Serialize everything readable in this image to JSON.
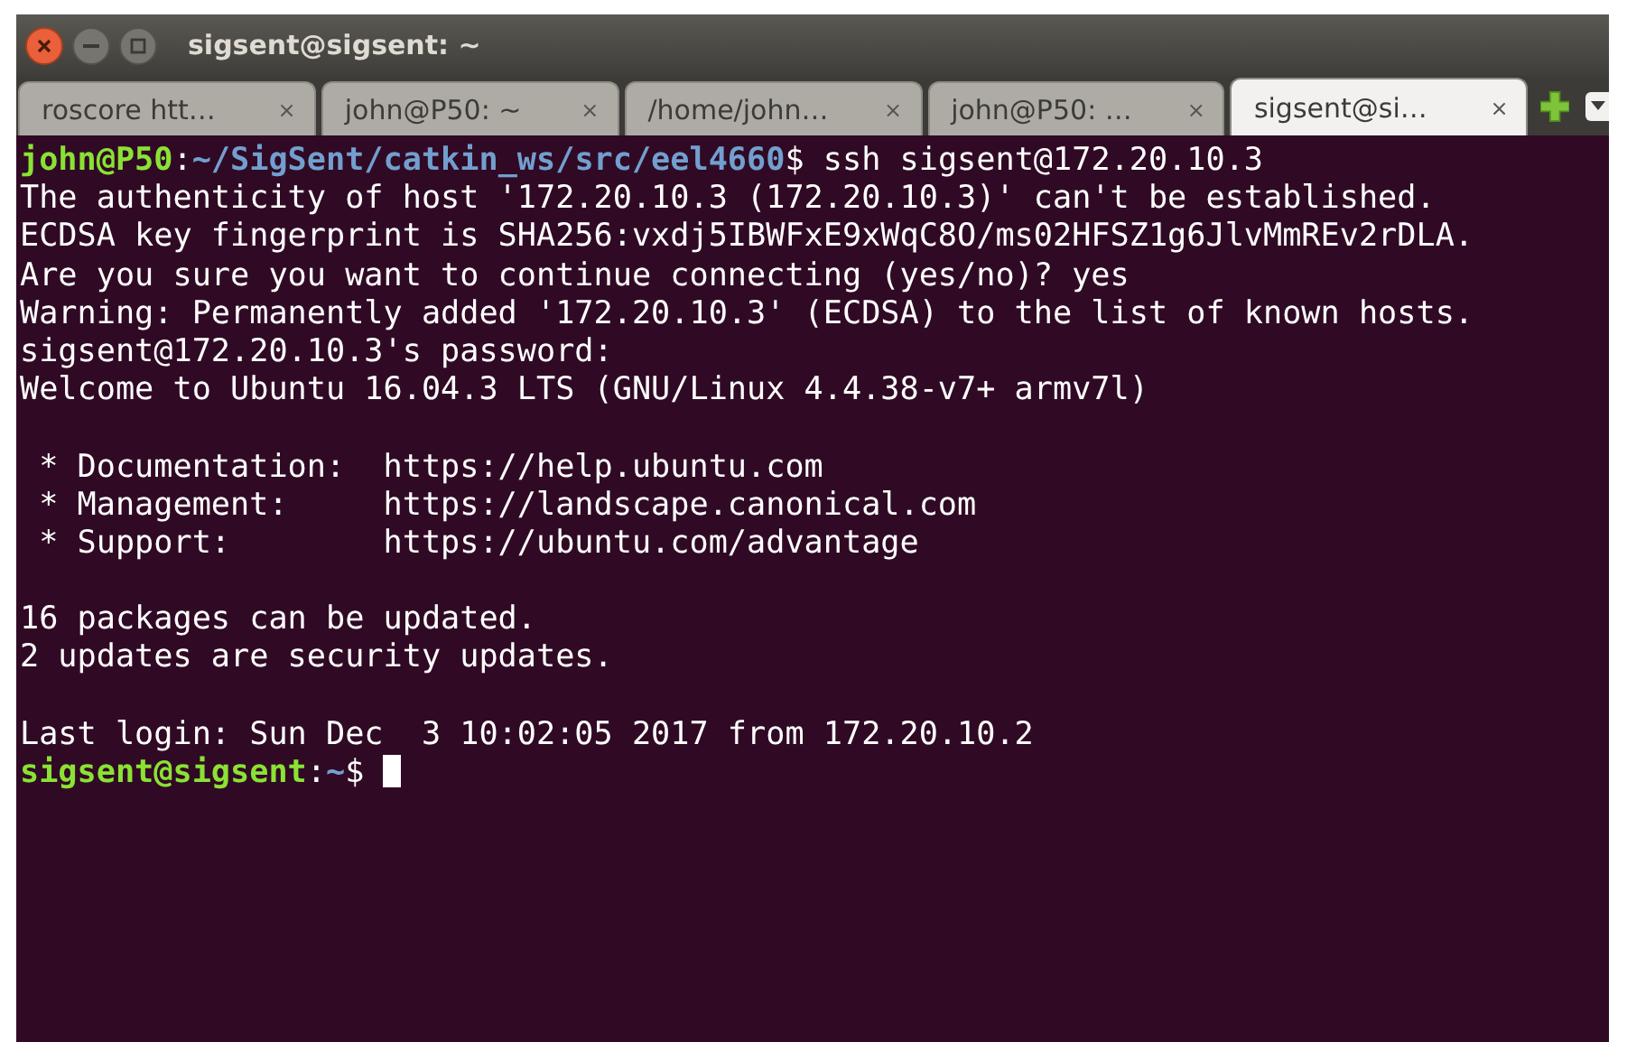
{
  "window": {
    "title": "sigsent@sigsent: ~"
  },
  "tabs": [
    {
      "label": "roscore htt…",
      "close": "×",
      "selected": false
    },
    {
      "label": "john@P50: ~",
      "close": "×",
      "selected": false
    },
    {
      "label": "/home/john…",
      "close": "×",
      "selected": false
    },
    {
      "label": "john@P50: …",
      "close": "×",
      "selected": false
    },
    {
      "label": "sigsent@si…",
      "close": "×",
      "selected": true
    }
  ],
  "terminal": {
    "lines": [
      {
        "kind": "prompt",
        "user": "john@P50",
        "separator": ":",
        "path": "~/SigSent/catkin_ws/src/eel4660",
        "rest": "$ ssh sigsent@172.20.10.3",
        "cursor": false
      },
      {
        "kind": "text",
        "text": "The authenticity of host '172.20.10.3 (172.20.10.3)' can't be established."
      },
      {
        "kind": "text",
        "text": "ECDSA key fingerprint is SHA256:vxdj5IBWFxE9xWqC8O/ms02HFSZ1g6JlvMmREv2rDLA."
      },
      {
        "kind": "text",
        "text": "Are you sure you want to continue connecting (yes/no)? yes"
      },
      {
        "kind": "text",
        "text": "Warning: Permanently added '172.20.10.3' (ECDSA) to the list of known hosts."
      },
      {
        "kind": "text",
        "text": "sigsent@172.20.10.3's password:"
      },
      {
        "kind": "text",
        "text": "Welcome to Ubuntu 16.04.3 LTS (GNU/Linux 4.4.38-v7+ armv7l)"
      },
      {
        "kind": "blank"
      },
      {
        "kind": "text",
        "text": " * Documentation:  https://help.ubuntu.com"
      },
      {
        "kind": "text",
        "text": " * Management:     https://landscape.canonical.com"
      },
      {
        "kind": "text",
        "text": " * Support:        https://ubuntu.com/advantage"
      },
      {
        "kind": "blank"
      },
      {
        "kind": "text",
        "text": "16 packages can be updated."
      },
      {
        "kind": "text",
        "text": "2 updates are security updates."
      },
      {
        "kind": "blank"
      },
      {
        "kind": "text",
        "text": "Last login: Sun Dec  3 10:02:05 2017 from 172.20.10.2"
      },
      {
        "kind": "prompt",
        "user": "sigsent@sigsent",
        "separator": ":",
        "path": "~",
        "rest": "$ ",
        "cursor": true
      }
    ]
  }
}
